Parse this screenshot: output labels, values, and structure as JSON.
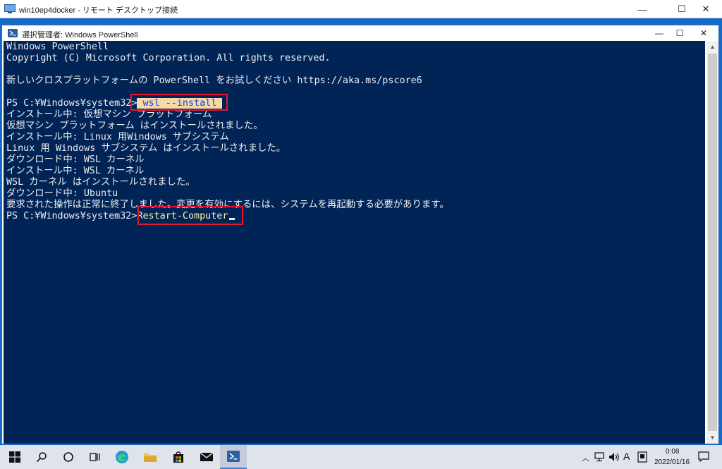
{
  "rdp": {
    "title": "win10ep4docker - リモート デスクトップ接続",
    "minimize": "—",
    "maximize": "☐",
    "close": "✕"
  },
  "powershell": {
    "title": "選択管理者: Windows PowerShell",
    "minimize": "—",
    "maximize": "☐",
    "close": "✕"
  },
  "console": {
    "lines": [
      "Windows PowerShell",
      "Copyright (C) Microsoft Corporation. All rights reserved.",
      "",
      "新しいクロスプラットフォームの PowerShell をお試しください https://aka.ms/pscore6",
      "",
      "",
      "インストール中: 仮想マシン プラットフォーム",
      "仮想マシン プラットフォーム はインストールされました。",
      "インストール中: Linux 用Windows サブシステム",
      "Linux 用 Windows サブシステム はインストールされました。",
      "ダウンロード中: WSL カーネル",
      "インストール中: WSL カーネル",
      "WSL カーネル はインストールされました。",
      "ダウンロード中: Ubuntu",
      "要求された操作は正常に終了しました。変更を有効にするには、システムを再起動する必要があります。"
    ],
    "prompt": "PS C:¥Windows¥system32>",
    "command1": " wsl --install ",
    "command2": "Restart-Computer"
  },
  "taskbar": {
    "icons": [
      "windows-start-icon",
      "search-icon",
      "cortana-icon",
      "task-view-icon",
      "edge-icon",
      "file-explorer-icon",
      "store-icon",
      "mail-icon",
      "powershell-icon"
    ],
    "time": "0:08",
    "date": "2022/01/16",
    "ime": "A"
  }
}
